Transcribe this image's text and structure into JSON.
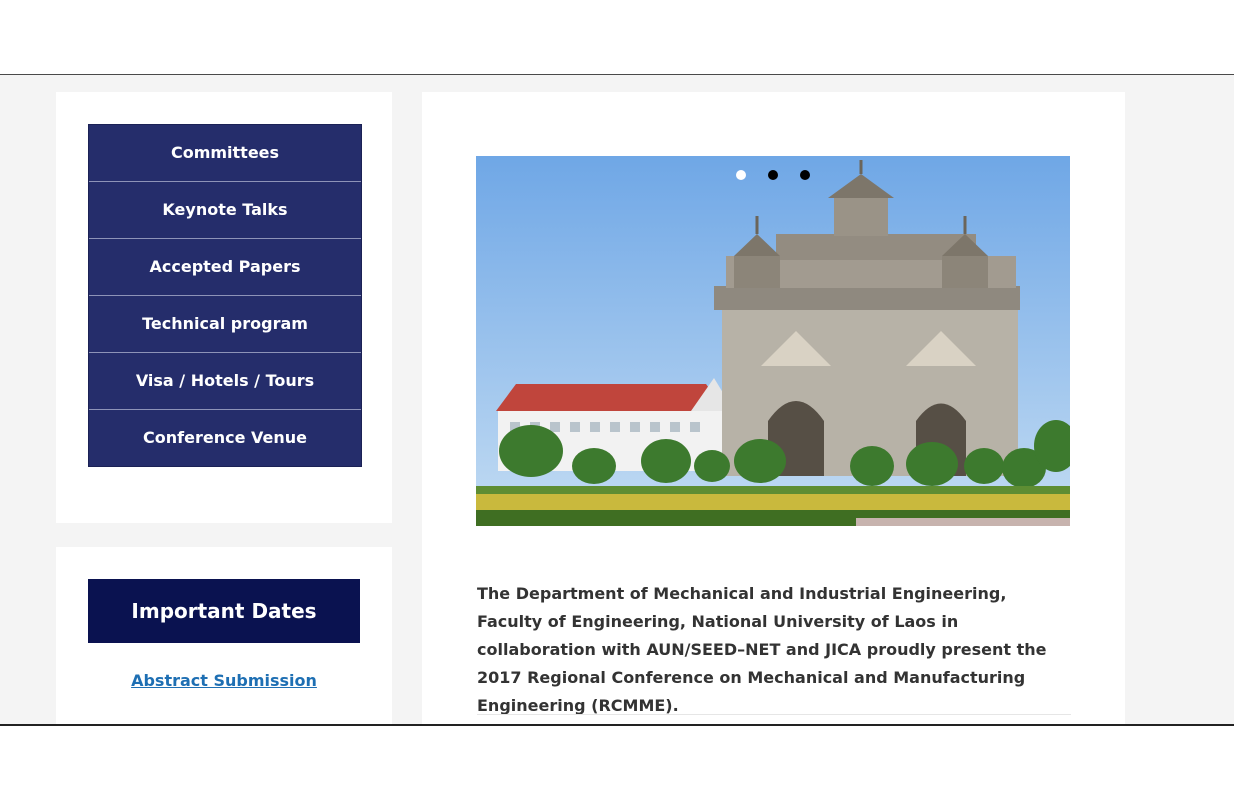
{
  "sidebar": {
    "menu_items": [
      {
        "label": "Committees"
      },
      {
        "label": "Keynote Talks"
      },
      {
        "label": "Accepted Papers"
      },
      {
        "label": "Technical program"
      },
      {
        "label": "Visa / Hotels / Tours"
      },
      {
        "label": "Conference Venue"
      }
    ],
    "important_dates": {
      "title": "Important Dates",
      "link_label": "Abstract Submission"
    }
  },
  "slider": {
    "slide_count": 3,
    "active_index": 0,
    "image_subject": "Patuxai monument, Vientiane"
  },
  "main": {
    "intro_text": "The Department of Mechanical and Industrial Engineering, Faculty of Engineering, National University of Laos in collaboration with AUN/SEED–NET and JICA proudly present the 2017 Regional Conference on Mechanical and Manufacturing Engineering (RCMME)."
  },
  "colors": {
    "menu_bg": "#252d6b",
    "dates_header_bg": "#0a1250",
    "link": "#1e6fb3",
    "page_bg": "#f4f4f4"
  }
}
